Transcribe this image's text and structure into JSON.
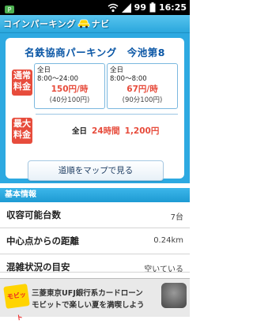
{
  "status_bar": {
    "battery": "99",
    "time": "16:25"
  },
  "app": {
    "title": "コインパーキング",
    "title_suffix": "ナビ"
  },
  "parking": {
    "name": "名鉄協商パーキング　今池第8",
    "regular_tag": [
      "通常",
      "料金"
    ],
    "max_tag": [
      "最大",
      "料金"
    ],
    "rates": [
      {
        "day": "全日",
        "time": "8:00～24:00",
        "price": "150円/時",
        "note": "(40分100円)"
      },
      {
        "day": "全日",
        "time": "8:00～8:00",
        "price": "67円/時",
        "note": "(90分100円)"
      }
    ],
    "max": {
      "day": "全日",
      "hours": "24時間",
      "price": "1,200円"
    },
    "map_button": "道順をマップで見る"
  },
  "basic_info": {
    "header": "基本情報",
    "rows": [
      {
        "label": "収容可能台数",
        "value": "7台"
      },
      {
        "label": "中心点からの距離",
        "value": "0.24km"
      },
      {
        "label": "混雑状況の目安",
        "value": "空いている"
      }
    ]
  },
  "ad": {
    "logo": "モビット",
    "line1": "三菱東京UFJ銀行系カードローン",
    "line2": "モビットで楽しい夏を満喫しよう"
  }
}
